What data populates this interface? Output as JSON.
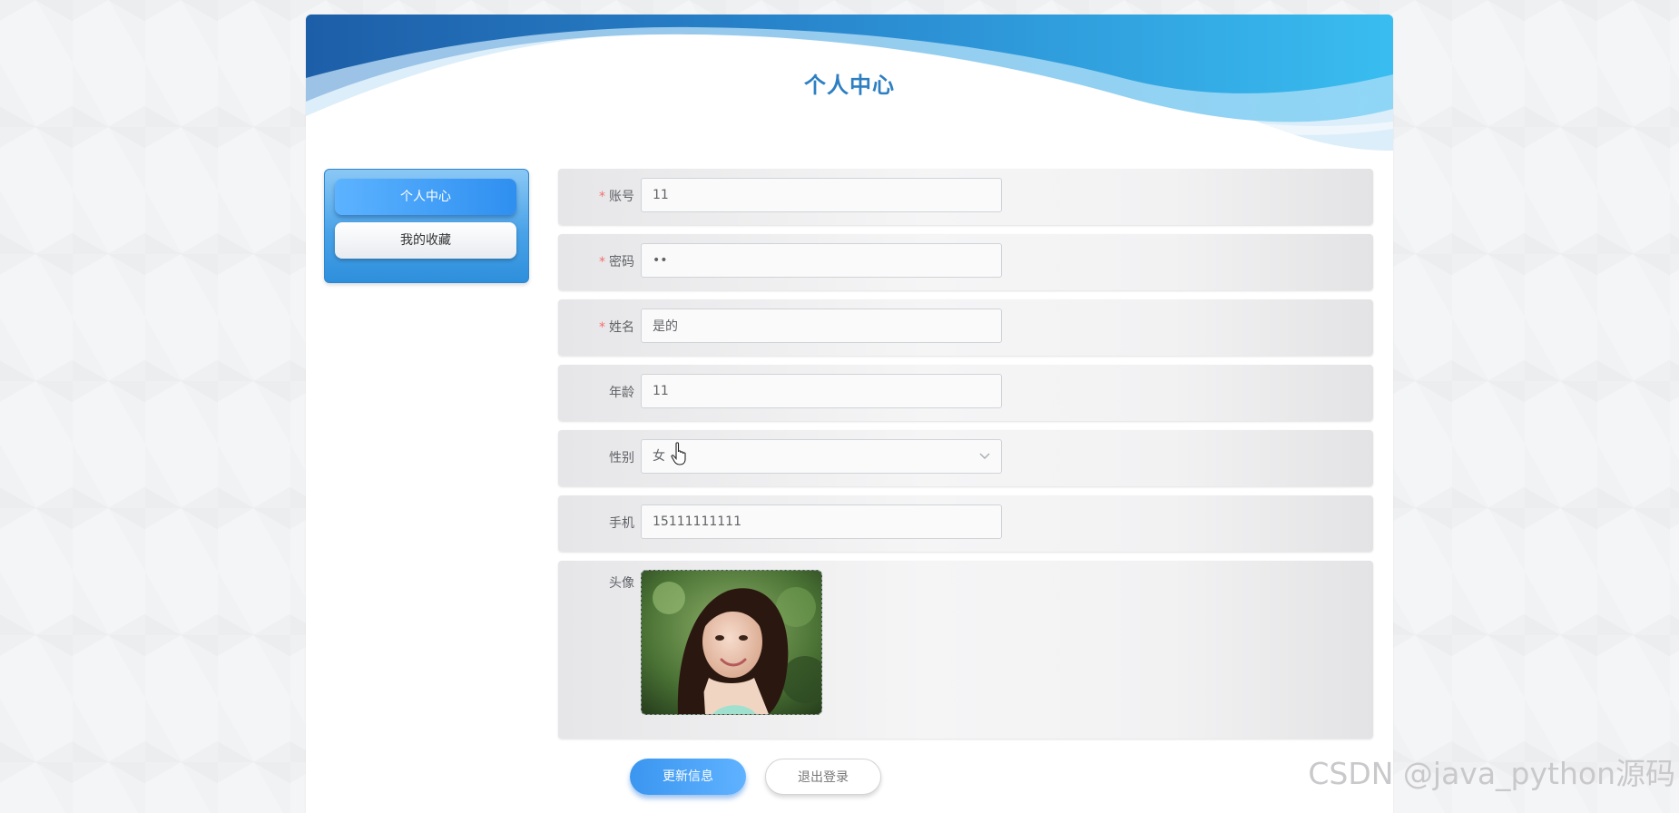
{
  "header": {
    "title": "个人中心",
    "title_color": "#2d7fc2"
  },
  "sidebar": {
    "items": [
      {
        "label": "个人中心",
        "active": true
      },
      {
        "label": "我的收藏",
        "active": false
      }
    ]
  },
  "form": {
    "account": {
      "label": "账号",
      "required": "*",
      "value": "11"
    },
    "password": {
      "label": "密码",
      "required": "*",
      "value": "••"
    },
    "name": {
      "label": "姓名",
      "required": "*",
      "value": "是的"
    },
    "age": {
      "label": "年龄",
      "value": "11"
    },
    "gender": {
      "label": "性别",
      "value": "女"
    },
    "phone": {
      "label": "手机",
      "value": "15111111111"
    },
    "avatar": {
      "label": "头像"
    }
  },
  "actions": {
    "update_label": "更新信息",
    "logout_label": "退出登录"
  },
  "watermark": "CSDN @java_python源码",
  "colors": {
    "accent": "#409eff",
    "required": "#f56c6c",
    "banner_dark": "#1a6fc0",
    "banner_light": "#3db8ee"
  },
  "icons": {
    "select_arrow": "chevron-down-icon",
    "pointer": "hand-pointer-icon"
  }
}
